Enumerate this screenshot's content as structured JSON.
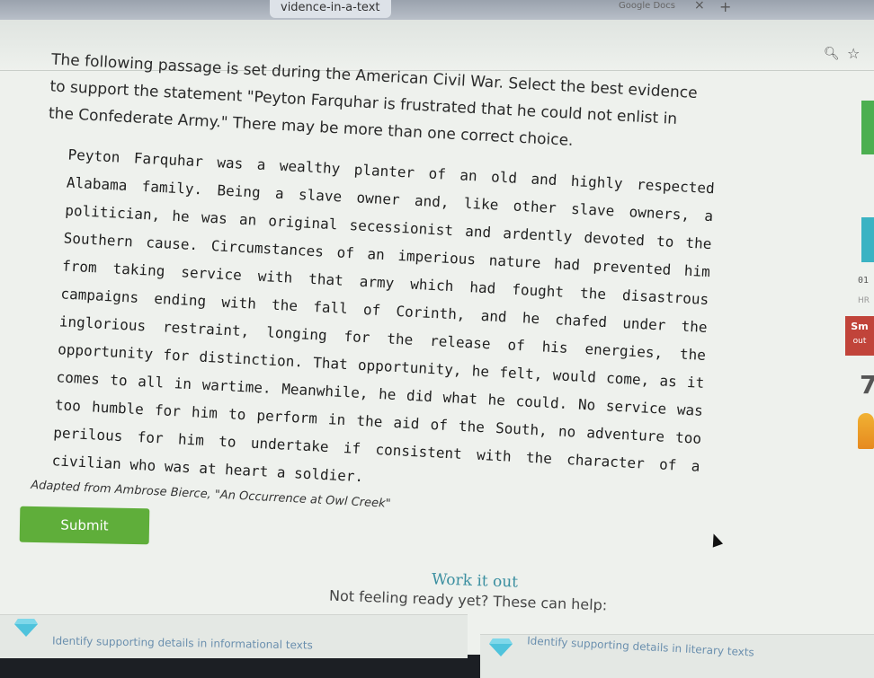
{
  "browser": {
    "tab_left_title": "vidence-in-a-text",
    "tab_right_title": "Google Docs",
    "close_glyph": "×",
    "new_tab_glyph": "+"
  },
  "toolbar": {
    "zoom_icon": "magnifier-icon",
    "bookmark_icon": "star-icon"
  },
  "question": {
    "text": "The following passage is set during the American Civil War. Select the best evidence to support the statement \"Peyton Farquhar is frustrated that he could not enlist in the Confederate Army.\" There may be more than one correct choice."
  },
  "passage": {
    "sentences": [
      "Peyton Farquhar was a wealthy planter of an old and highly respected Alabama family.",
      "Being a slave owner and, like other slave owners, a politician, he was an original secessionist and ardently devoted to the Southern cause.",
      "Circumstances of an imperious nature had prevented him from taking service with that army which had fought the disastrous campaigns ending with the fall of Corinth, and he chafed under the inglorious restraint, longing for the release of his energies, the opportunity for distinction.",
      "That opportunity, he felt, would come, as it comes to all in wartime.",
      "Meanwhile, he did what he could.",
      "No service was too humble for him to perform in the aid of the South, no adventure too perilous for him to undertake if consistent with the character of a civilian who was at heart a soldier."
    ]
  },
  "source": "Adapted from Ambrose Bierce, \"An Occurrence at Owl Creek\"",
  "actions": {
    "submit_label": "Submit"
  },
  "help": {
    "work_it_out": "Work it out",
    "not_ready": "Not feeling ready yet? These can help:",
    "links": [
      "Identify supporting details in informational texts",
      "Identify supporting details in literary texts"
    ]
  },
  "sidebar": {
    "number": "01",
    "hr_label": "HR",
    "sm_label": "Sm",
    "out_label": "out",
    "big_digit": "7"
  }
}
